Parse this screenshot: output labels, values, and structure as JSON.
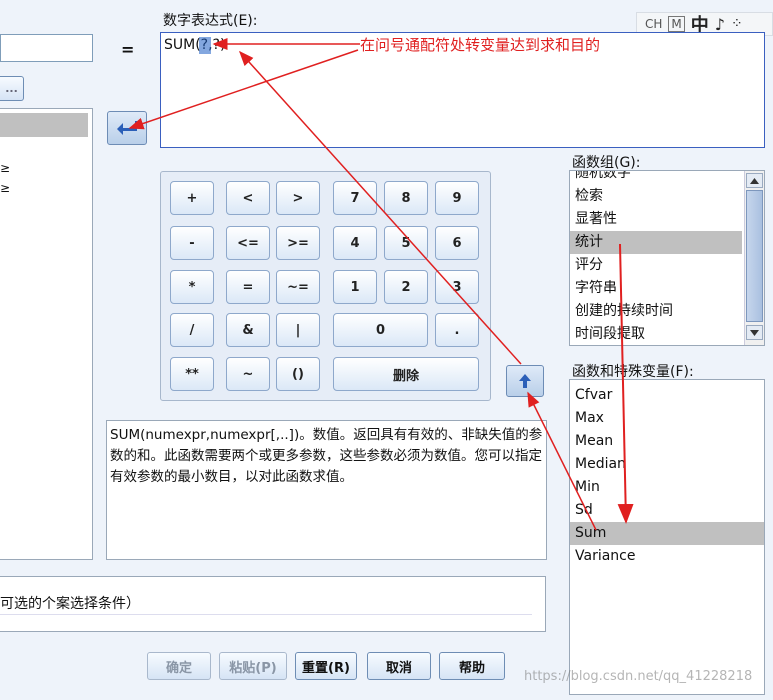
{
  "expression_label": "数字表达式(E):",
  "expression_value": "SUM(?,?)",
  "equals_sign": "=",
  "annotation_text": "在问号通配符处转变量达到求和目的",
  "ime": {
    "ch": "CH",
    "m": "M",
    "zhong": "中",
    "music": "♪",
    "dots": "⁘"
  },
  "left_partial": {
    "glyph1": "≥",
    "glyph2": "≥",
    "small_button": "..."
  },
  "keypad": {
    "plus": "+",
    "lt": "<",
    "gt": ">",
    "seven": "7",
    "eight": "8",
    "nine": "9",
    "minus": "-",
    "le": "<=",
    "ge": ">=",
    "four": "4",
    "five": "5",
    "six": "6",
    "mul": "*",
    "eq": "=",
    "ne": "~=",
    "one": "1",
    "two": "2",
    "three": "3",
    "div": "/",
    "and": "&",
    "or": "|",
    "zero": "0",
    "dot": ".",
    "pow": "**",
    "not": "~",
    "paren": "()",
    "delete": "删除"
  },
  "function_group": {
    "label": "函数组(G):",
    "items": [
      "随机数字",
      "检索",
      "显著性",
      "统计",
      "评分",
      "字符串",
      "创建的持续时间",
      "时间段提取"
    ],
    "selected_index": 3
  },
  "function_list": {
    "label": "函数和特殊变量(F):",
    "items": [
      "Cfvar",
      "Max",
      "Mean",
      "Median",
      "Min",
      "Sd",
      "Sum",
      "Variance"
    ],
    "selected_index": 6
  },
  "description": "SUM(numexpr,numexpr[,..])。数值。返回具有有效的、非缺失值的参数的和。此函数需要两个或更多参数，这些参数必须为数值。您可以指定有效参数的最小数目，以对此函数求值。",
  "condition_text": "可选的个案选择条件）",
  "buttons": {
    "ok": "确定",
    "paste": "粘贴(P)",
    "reset": "重置(R)",
    "cancel": "取消",
    "help": "帮助"
  },
  "watermark": "https://blog.csdn.net/qq_41228218",
  "colors": {
    "annotation": "#e02020",
    "selection": "#c0c0c0",
    "accent": "#2b5fb8"
  }
}
